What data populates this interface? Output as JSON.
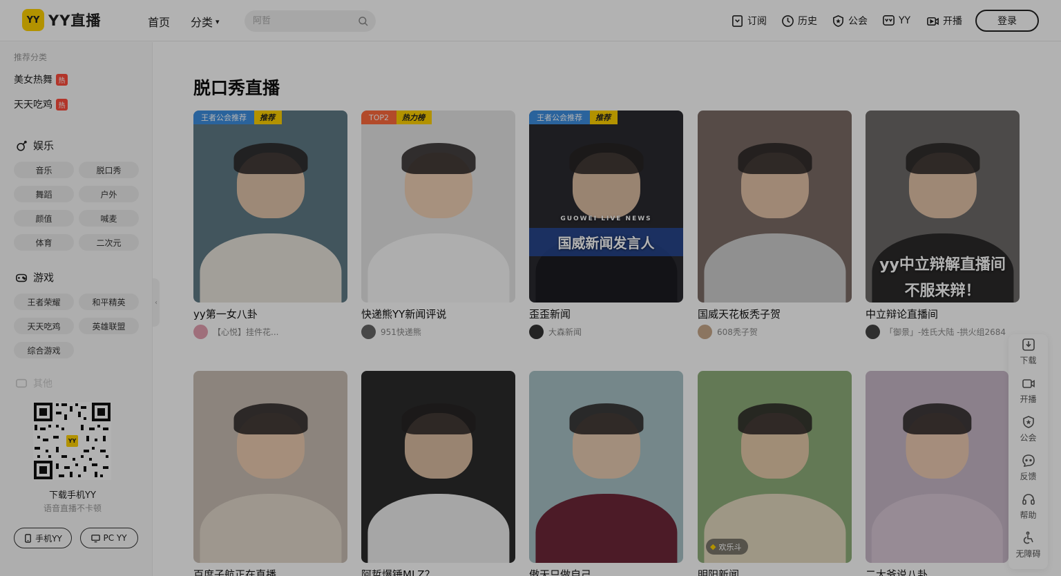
{
  "header": {
    "logo_mark": "YY",
    "logo_text": "YY直播",
    "nav_home": "首页",
    "nav_category": "分类",
    "search_placeholder": "阿哲",
    "items": [
      {
        "label": "订阅",
        "icon": "bookmark-icon"
      },
      {
        "label": "历史",
        "icon": "clock-icon"
      },
      {
        "label": "公会",
        "icon": "shield-star-icon"
      },
      {
        "label": "YY",
        "icon": "yy-icon"
      },
      {
        "label": "开播",
        "icon": "video-camera-icon"
      }
    ],
    "login_label": "登录"
  },
  "sidebar": {
    "recommend_title": "推荐分类",
    "hot_items": [
      {
        "label": "美女热舞",
        "badge": "热"
      },
      {
        "label": "天天吃鸡",
        "badge": "热"
      }
    ],
    "sections": [
      {
        "title": "娱乐",
        "icon": "microphone-icon",
        "items": [
          "音乐",
          "脱口秀",
          "舞蹈",
          "户外",
          "颜值",
          "喊麦",
          "体育",
          "二次元"
        ]
      },
      {
        "title": "游戏",
        "icon": "gamepad-icon",
        "items": [
          "王者荣耀",
          "和平精英",
          "天天吃鸡",
          "英雄联盟",
          "综合游戏"
        ]
      }
    ],
    "more_label": "其他",
    "qr_title": "下载手机YY",
    "qr_subtitle": "语音直播不卡顿",
    "btn_mobile": "手机YY",
    "btn_pc": "PC YY"
  },
  "main": {
    "title": "脱口秀直播",
    "cards": [
      {
        "title": "yy第一女八卦",
        "anchor": "【心悦】挂件花...",
        "tag_a": "王者公会推荐",
        "tag_b": "推荐",
        "tag_color": "#3d8fe0",
        "bg": "#5f7a86",
        "body": "#e8e4dc",
        "av": "#e4a0b0"
      },
      {
        "title": "快递熊YY新闻评说",
        "anchor": "951快递熊",
        "tag_a": "TOP2",
        "tag_b": "热力榜",
        "tag_color": "#ff6a3d",
        "bg": "#e6e6e6",
        "body": "#fafafa",
        "av": "#666666"
      },
      {
        "title": "歪歪新闻",
        "anchor": "大森新闻",
        "tag_a": "王者公会推荐",
        "tag_b": "推荐",
        "tag_color": "#3d8fe0",
        "bg": "#2a2a30",
        "body": "#1c1c22",
        "av": "#333333",
        "overlay": "国威新闻发言人",
        "overlay_sub": "GUOWEI LIVE NEWS"
      },
      {
        "title": "国威天花板秃子贺",
        "anchor": "608秃子贺",
        "bg": "#7b6c66",
        "body": "#cfcfcf",
        "av": "#c8a88a"
      },
      {
        "title": "中立辩论直播间",
        "anchor": "「御景」-姓氏大陆 -拱火组2684",
        "bg": "#6d6b69",
        "body": "#2b2a2a",
        "av": "#444444",
        "overlay": "yy中立辩解直播间",
        "overlay_sub": "不服来辩！"
      },
      {
        "title": "百度子航正在直播",
        "anchor": "",
        "bg": "#c9beb3",
        "body": "#e2d8cc",
        "av": "#999999"
      },
      {
        "title": "阿哲爆锤MLZ？",
        "anchor": "",
        "bg": "#2b2b2b",
        "body": "#eeeeee",
        "av": "#999999"
      },
      {
        "title": "傲天只做自己",
        "anchor": "",
        "bg": "#a8c2c6",
        "body": "#6e2838",
        "av": "#999999"
      },
      {
        "title": "明阳新闻",
        "anchor": "",
        "bg": "#8fae7a",
        "body": "#e3d8bf",
        "av": "#999999",
        "game_tag": "欢乐斗"
      },
      {
        "title": "二大爷说八卦",
        "anchor": "",
        "bg": "#c8b8c8",
        "body": "#d8c8d6",
        "av": "#999999"
      }
    ]
  },
  "toolbar": {
    "items": [
      {
        "label": "下载",
        "icon": "download-icon"
      },
      {
        "label": "开播",
        "icon": "video-camera-icon"
      },
      {
        "label": "公会",
        "icon": "shield-star-icon"
      },
      {
        "label": "反馈",
        "icon": "feedback-icon"
      },
      {
        "label": "帮助",
        "icon": "headset-icon"
      },
      {
        "label": "无障碍",
        "icon": "wheelchair-icon"
      }
    ]
  }
}
